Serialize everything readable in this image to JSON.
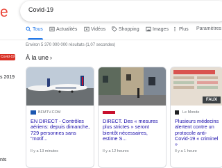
{
  "logo_fragment": "e",
  "search": {
    "query": "Covid-19"
  },
  "tabs": [
    {
      "label": "Tous",
      "icon": "search-icon"
    },
    {
      "label": "Actualités",
      "icon": "news-icon"
    },
    {
      "label": "Vidéos",
      "icon": "video-icon"
    },
    {
      "label": "Shopping",
      "icon": "tag-icon"
    },
    {
      "label": "Images",
      "icon": "image-icon"
    },
    {
      "label": "Plus",
      "icon": "more-icon"
    },
    {
      "label": "Paramètres",
      "icon": ""
    }
  ],
  "stats": "Environ 5 370 000 000 résultats (1,07 secondes)",
  "section_title": "À la une",
  "section_chevron": "›",
  "left_panel": {
    "badge": "Covid-19",
    "line1": "s 2019",
    "line2": "nts"
  },
  "cards": [
    {
      "source": "BFMTV.COM",
      "headline": "EN DIRECT - Contrôles aériens: depuis dimanche, 729 personnes sans \"motif...",
      "time": "Il y a 13 minutes"
    },
    {
      "source": "",
      "headline": "DIRECT. Des « mesures plus strictes » seront bientôt nécessaires, estime S...",
      "time": "Il y a 12 heures"
    },
    {
      "source": "Le Monde",
      "headline": "Plusieurs médecins alertent contre un protocole anti-Covid-19 « criminel »",
      "time": "Il y a 1 heure",
      "overlay": "FAUX"
    }
  ],
  "colors": {
    "accent": "#1a73e8",
    "link": "#1a0dab",
    "badge": "#d93025"
  }
}
